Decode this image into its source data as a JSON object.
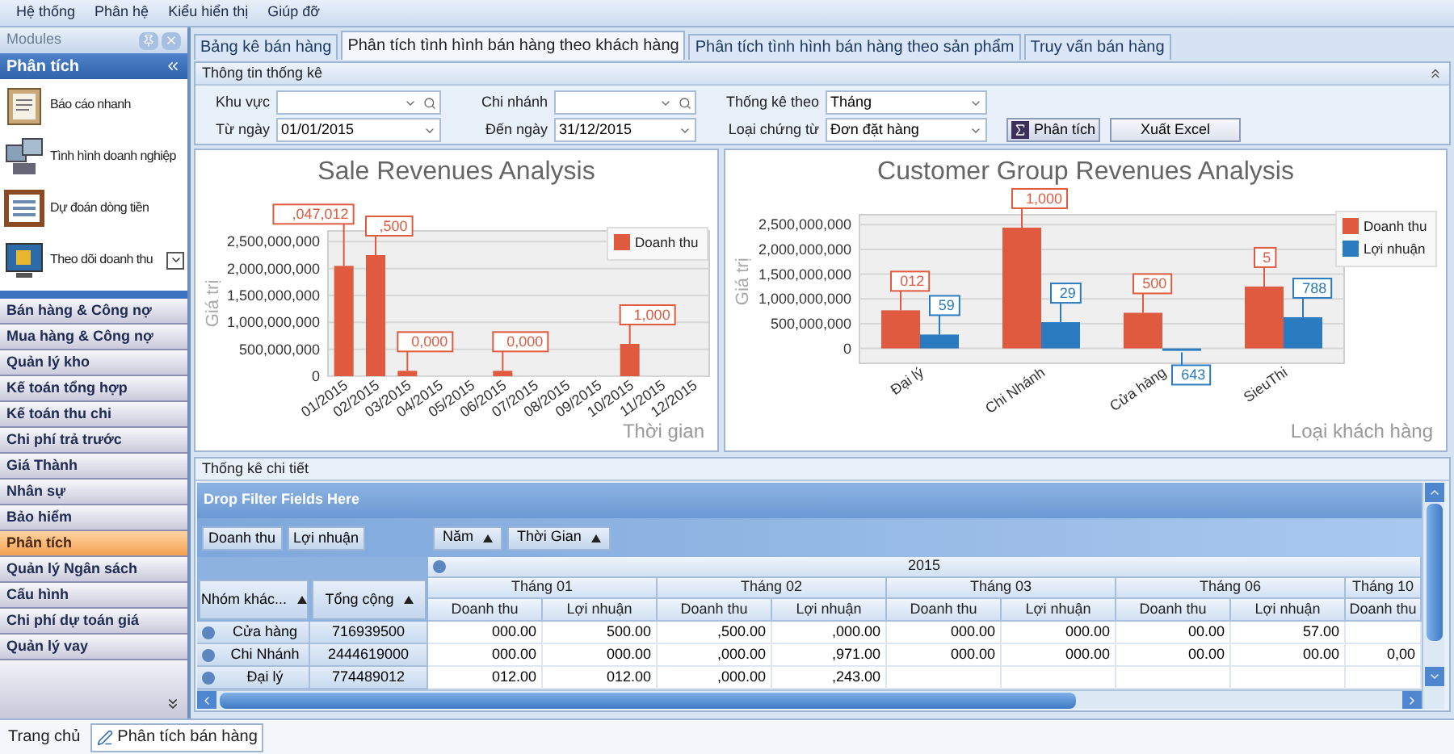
{
  "menu_bar": [
    "Hệ thống",
    "Phân hệ",
    "Kiểu hiển thị",
    "Giúp đỡ"
  ],
  "modules_panel": {
    "title": "Modules",
    "section": "Phân tích",
    "quick_items": [
      {
        "label": "Báo cáo nhanh",
        "kind": "clipboard"
      },
      {
        "label": "Tình hình doanh nghiệp",
        "kind": "computers"
      },
      {
        "label": "Dự đoán dòng tiền",
        "kind": "abacus"
      },
      {
        "label": "Theo dõi doanh thu",
        "kind": "monitor"
      }
    ],
    "nav_items": [
      {
        "label": "Bán hàng & Công nợ",
        "selected": false
      },
      {
        "label": "Mua hàng & Công nợ",
        "selected": false
      },
      {
        "label": "Quản lý kho",
        "selected": false
      },
      {
        "label": "Kế toán tổng hợp",
        "selected": false
      },
      {
        "label": "Kế toán thu chi",
        "selected": false
      },
      {
        "label": "Chi phí trả trước",
        "selected": false
      },
      {
        "label": "Giá Thành",
        "selected": false
      },
      {
        "label": "Nhân sự",
        "selected": false
      },
      {
        "label": "Bảo hiểm",
        "selected": false
      },
      {
        "label": "Phân tích",
        "selected": true
      },
      {
        "label": "Quản lý Ngân sách",
        "selected": false
      },
      {
        "label": "Cấu hình",
        "selected": false
      },
      {
        "label": "Chi phí dự toán giá",
        "selected": false
      },
      {
        "label": "Quản lý vay",
        "selected": false
      }
    ]
  },
  "tabs": [
    {
      "label": "Bảng kê bán hàng",
      "selected": false
    },
    {
      "label": "Phân tích tình hình bán hàng theo khách hàng",
      "selected": true
    },
    {
      "label": "Phân tích tình hình bán hàng theo sản phẩm",
      "selected": false
    },
    {
      "label": "Truy vấn bán hàng",
      "selected": false
    }
  ],
  "filter_panel": {
    "title": "Thông tin thống kê",
    "rows": [
      [
        {
          "label": "Khu vực",
          "kind": "search"
        },
        {
          "label": "Chi nhánh",
          "kind": "search"
        },
        {
          "label": "Thống kê theo",
          "value": "Tháng",
          "kind": "combo"
        }
      ],
      [
        {
          "label": "Từ ngày",
          "value": "01/01/2015",
          "kind": "combo"
        },
        {
          "label": "Đến ngày",
          "value": "31/12/2015",
          "kind": "combo"
        },
        {
          "label": "Loại chứng từ",
          "value": "Đơn đặt hàng",
          "kind": "combo"
        }
      ]
    ],
    "buttons": [
      {
        "label": "Phân tích",
        "kind": "sigma"
      },
      {
        "label": "Xuất Excel",
        "kind": "plain"
      }
    ]
  },
  "charts": [
    {
      "chart_data": {
        "type": "bar",
        "title": "Sale Revenues Analysis",
        "xlabel": "Thời gian",
        "ylabel": "Giá trị",
        "categories": [
          "01/2015",
          "02/2015",
          "03/2015",
          "04/2015",
          "05/2015",
          "06/2015",
          "07/2015",
          "08/2015",
          "09/2015",
          "10/2015",
          "11/2015",
          "12/2015"
        ],
        "series": [
          {
            "name": "Doanh thu",
            "color": "#e05a3f",
            "values": [
              2050000000,
              2250000000,
              100000000,
              null,
              null,
              100000000,
              null,
              null,
              null,
              600000000,
              null,
              null
            ]
          }
        ],
        "ylim": [
          0,
          2700000000
        ],
        "grid": true,
        "legend": true,
        "yticks": [
          {
            "value": 0,
            "label": "0"
          },
          {
            "value": 500000000,
            "label": "500,000,000"
          },
          {
            "value": 1000000000,
            "label": "1,000,000,000"
          },
          {
            "value": 1500000000,
            "label": "1,500,000,000"
          },
          {
            "value": 2000000000,
            "label": "2,000,000,000"
          },
          {
            "value": 2500000000,
            "label": "2,500,000,000"
          }
        ],
        "value_labels": [
          [
            ",047,012",
            ",500",
            "0,000",
            null,
            null,
            "0,000",
            null,
            null,
            null,
            "1,000",
            null,
            null
          ]
        ]
      }
    },
    {
      "chart_data": {
        "type": "bar",
        "title": "Customer Group Revenues Analysis",
        "xlabel": "Loại khách hàng",
        "ylabel": "Giá trị",
        "categories": [
          "Đại lý",
          "Chi Nhánh",
          "Cửa hàng",
          "SieuThi"
        ],
        "series": [
          {
            "name": "Doanh thu",
            "color": "#e05a3f",
            "values": [
              770000000,
              2440000000,
              720000000,
              1250000000
            ]
          },
          {
            "name": "Lợi nhuận",
            "color": "#2a7bbf",
            "values": [
              280000000,
              530000000,
              -30000000,
              630000000
            ]
          }
        ],
        "ylim": [
          -300000000,
          2700000000
        ],
        "grid": true,
        "legend": true,
        "yticks": [
          {
            "value": 0,
            "label": "0"
          },
          {
            "value": 500000000,
            "label": "500,000,000"
          },
          {
            "value": 1000000000,
            "label": "1,000,000,000"
          },
          {
            "value": 1500000000,
            "label": "1,500,000,000"
          },
          {
            "value": 2000000000,
            "label": "2,000,000,000"
          },
          {
            "value": 2500000000,
            "label": "2,500,000,000"
          }
        ],
        "value_labels": [
          [
            "012",
            "1,000",
            "500",
            "5"
          ],
          [
            "59",
            "29",
            "643",
            "788"
          ]
        ]
      }
    }
  ],
  "detail": {
    "title": "Thống kê chi tiết",
    "drop_hint": "Drop Filter Fields Here",
    "data_fields": [
      "Doanh thu",
      "Lợi nhuận"
    ],
    "column_fields": [
      "Năm",
      "Thời Gian"
    ],
    "row_fields": [
      "Nhóm khác...",
      "Tổng cộng"
    ],
    "year": "2015",
    "months": [
      {
        "label": "Tháng 01",
        "measures": [
          "Doanh thu",
          "Lợi nhuận"
        ]
      },
      {
        "label": "Tháng 02",
        "measures": [
          "Doanh thu",
          "Lợi nhuận"
        ]
      },
      {
        "label": "Tháng 03",
        "measures": [
          "Doanh thu",
          "Lợi nhuận"
        ]
      },
      {
        "label": "Tháng 06",
        "measures": [
          "Doanh thu",
          "Lợi nhuận"
        ]
      },
      {
        "label": "Tháng 10",
        "measures": [
          "Doanh thu"
        ]
      }
    ],
    "rows": [
      {
        "label": "Cửa hàng",
        "total": "716939500",
        "cells": [
          "000.00",
          "500.00",
          ",500.00",
          ",000.00",
          "000.00",
          "000.00",
          "00.00",
          "57.00"
        ]
      },
      {
        "label": "Chi Nhánh",
        "total": "2444619000",
        "cells": [
          "000.00",
          "000.00",
          ",000.00",
          ",971.00",
          "000.00",
          "000.00",
          "00.00",
          "00.00",
          "0,00"
        ]
      },
      {
        "label": "Đại lý",
        "total": "774489012",
        "cells": [
          "012.00",
          "012.00",
          ",000.00",
          ",243.00"
        ]
      }
    ]
  },
  "status_bar": [
    {
      "label": "Trang chủ",
      "selected": false
    },
    {
      "label": "Phân tích bán hàng",
      "selected": true
    }
  ]
}
